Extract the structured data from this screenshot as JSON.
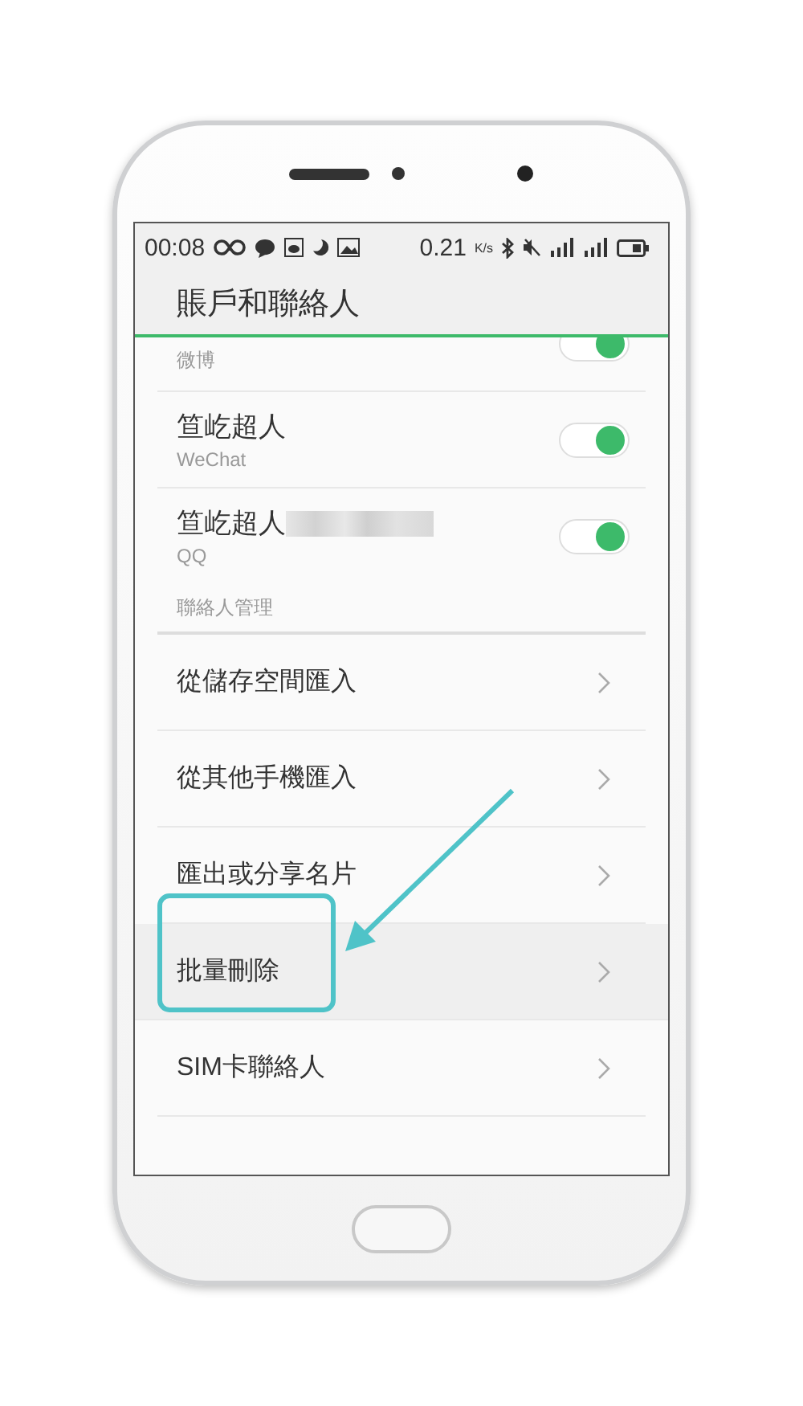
{
  "status_bar": {
    "time": "00:08",
    "speed": "0.21",
    "speed_unit": "K/s"
  },
  "header": {
    "title": "賬戶和聯絡人"
  },
  "accounts": [
    {
      "subtitle": "微博",
      "on": true,
      "redacted": false
    },
    {
      "title": "笪屹超人",
      "subtitle": "WeChat",
      "on": true,
      "redacted": false
    },
    {
      "title": "笪屹超人",
      "subtitle": "QQ",
      "on": true,
      "redacted": true
    }
  ],
  "section_label": "聯絡人管理",
  "menu": [
    {
      "label": "從儲存空間匯入",
      "highlighted": false
    },
    {
      "label": "從其他手機匯入",
      "highlighted": false
    },
    {
      "label": "匯出或分享名片",
      "highlighted": false
    },
    {
      "label": "批量刪除",
      "highlighted": true
    },
    {
      "label": "SIM卡聯絡人",
      "highlighted": false
    }
  ]
}
